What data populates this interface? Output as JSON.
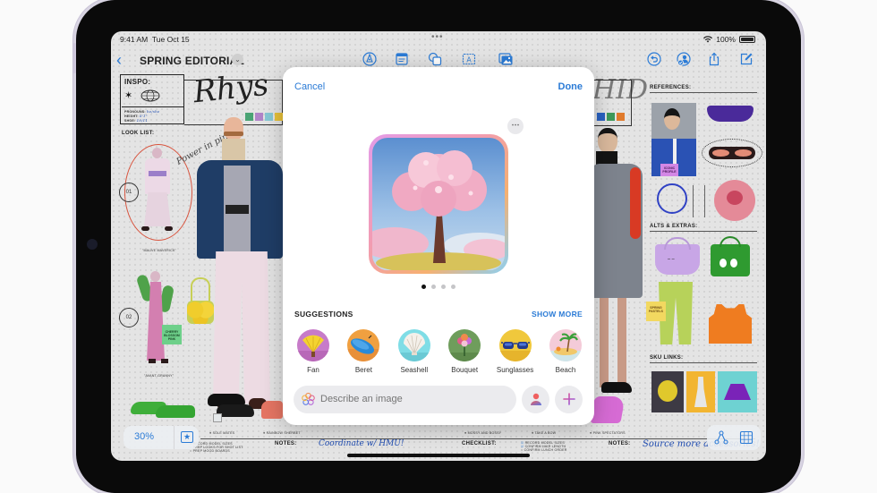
{
  "status_bar": {
    "time": "9:41 AM",
    "date": "Tue Oct 15",
    "battery": "100%",
    "dots": "•••"
  },
  "toolbar": {
    "back_icon": "chevron-left-icon",
    "title": "SPRING EDITORIAL",
    "title_menu_icon": "chevron-down-icon",
    "center_tools": [
      "pen-tip-icon",
      "text-block-icon",
      "shapes-icon",
      "text-box-icon",
      "media-icon"
    ],
    "right_tools": [
      "undo-icon",
      "collaborate-icon",
      "share-icon",
      "compose-icon"
    ]
  },
  "board": {
    "inspo": {
      "label": "INSPO:",
      "fields": [
        {
          "key": "PRONOUNS:",
          "value": "he/she"
        },
        {
          "key": "HEIGHT:",
          "value": "6'1\""
        },
        {
          "key": "SHOE:",
          "value": "10/11"
        }
      ]
    },
    "signature": "Rhys",
    "signature_right": "HID",
    "look_list_label": "LOOK LIST:",
    "look_numbers": [
      "01",
      "02"
    ],
    "look_captions": [
      "\"MAUVE MAVERICK\"",
      "\"AVANT-GRANNY\""
    ],
    "handwriting_power": "Power in pink",
    "sticky_cherry": "CHERRY BLOSSOM PINK",
    "references_label": "REFERENCES:",
    "iconic_profile": "ICONIC PROFILE",
    "alts_label": "ALTS & EXTRAS:",
    "spring_pastels": "SPRING PASTELS",
    "sku_label": "SKU LINKS:",
    "shoe_bullets": [
      "SOLE MATES",
      "RAINBOW SHERBET",
      "MOSSY AND BOSSY",
      "TAKE A BOW",
      "PINK SPECTATORS"
    ],
    "notes_label": "NOTES:",
    "notes_left": "Coordinate w/ HMU!",
    "notes_right": "Source more accessories!",
    "checklist_label": "CHECKLIST:",
    "todo_left": [
      "RECORD MODEL SIZES",
      "PREP LOOKS FOR SHOT LIST",
      "PREP MOOD BOARDS"
    ],
    "checklist_items": [
      {
        "label": "RECORD MODEL SIZES",
        "checked": true
      },
      {
        "label": "CONFIRM HAIR LENGTH",
        "checked": true
      },
      {
        "label": "CONFIRM LUNCH ORDER",
        "checked": false
      }
    ],
    "palette_left": [
      "#4aa374",
      "#b084c8",
      "#86c8d4",
      "#e8c23a"
    ],
    "palette_right": [
      "#2a62c2",
      "#3f9a5a",
      "#e07a2c"
    ]
  },
  "modal": {
    "cancel_label": "Cancel",
    "done_label": "Done",
    "more_icon": "ellipsis-icon",
    "preview_subject": "cherry blossom tree",
    "page_count": 4,
    "current_page": 1,
    "suggestions_title": "SUGGESTIONS",
    "show_more_label": "SHOW MORE",
    "suggestions": [
      {
        "label": "Fan",
        "icon": "fan-icon",
        "bg": "#c77bc9"
      },
      {
        "label": "Beret",
        "icon": "beret-icon",
        "bg": "#f0a040"
      },
      {
        "label": "Seashell",
        "icon": "seashell-icon",
        "bg": "#7fdde6"
      },
      {
        "label": "Bouquet",
        "icon": "bouquet-icon",
        "bg": "#6f9d5c"
      },
      {
        "label": "Sunglasses",
        "icon": "sunglasses-icon",
        "bg": "#f0c83c"
      },
      {
        "label": "Beach",
        "icon": "beach-icon",
        "bg": "#f4cbd8"
      }
    ],
    "input_placeholder": "Describe an image",
    "person_button_icon": "person-icon",
    "add_button_icon": "plus-icon"
  },
  "bottom_controls": {
    "zoom_level": "30%",
    "favorite_icon": "star-icon",
    "connector_icon": "connector-icon",
    "grid_icon": "grid-icon"
  },
  "colors": {
    "accent": "#2b7bd6"
  }
}
